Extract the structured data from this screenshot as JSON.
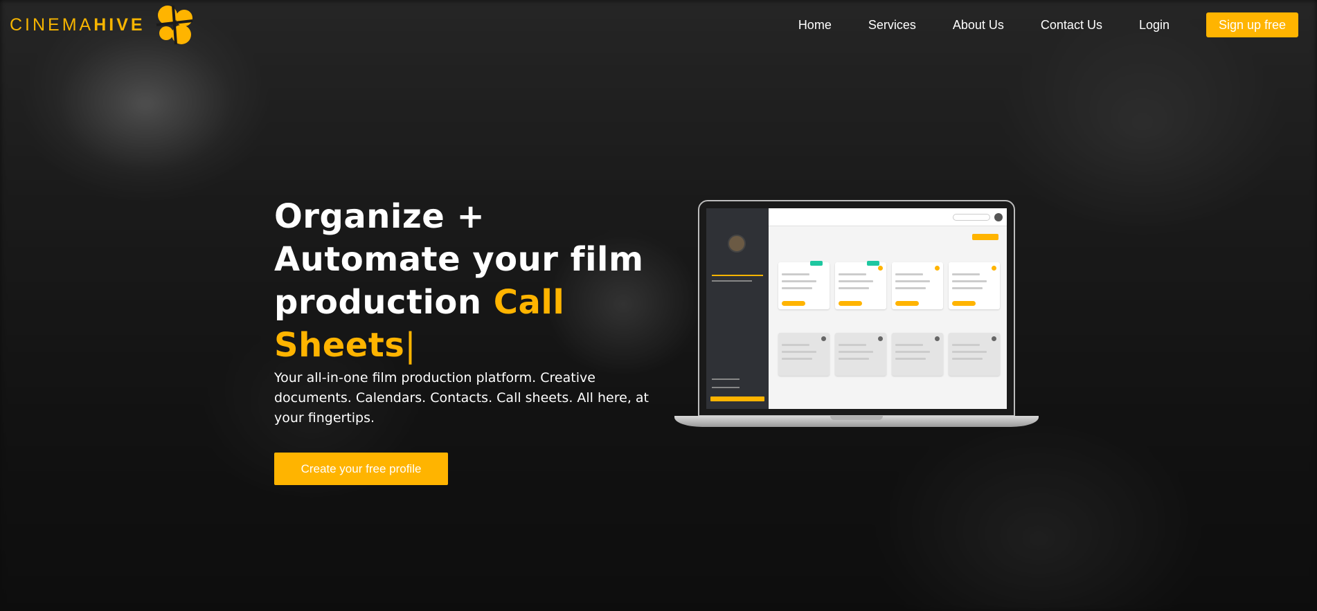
{
  "brand": {
    "name_part1": "CINEMA",
    "name_part2": "HIVE",
    "accent_color": "#ffb400"
  },
  "nav": {
    "links": [
      "Home",
      "Services",
      "About Us",
      "Contact Us",
      "Login"
    ],
    "signup_label": "Sign up free"
  },
  "hero": {
    "title_line1": "Organize +",
    "title_line2": "Automate your film",
    "title_line3_plain": "production",
    "title_highlight1": "Call",
    "title_highlight2": "Sheets",
    "cursor": "|",
    "subtitle": "Your all-in-one film production platform. Creative documents. Calendars. Contacts. Call sheets. All here, at your fingertips.",
    "cta_label": "Create your free profile"
  }
}
